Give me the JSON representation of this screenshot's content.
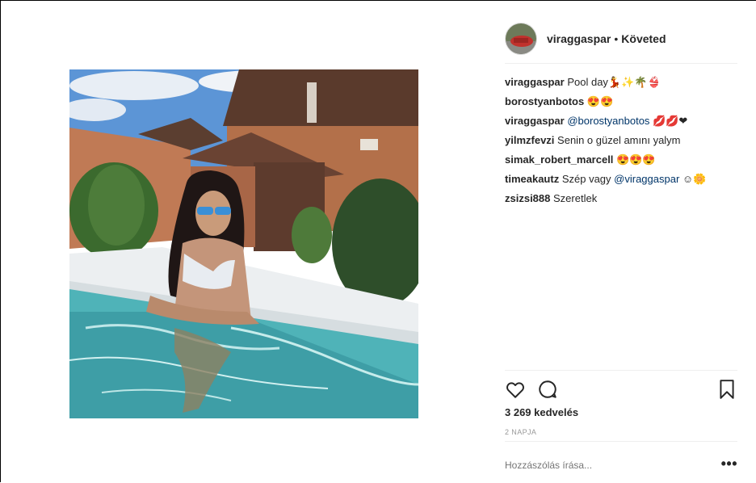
{
  "post": {
    "username": "viraggaspar",
    "separator": "•",
    "follow_status": "Követed"
  },
  "comments": [
    {
      "user": "viraggaspar",
      "text": "Pool day💃✨🌴👙"
    },
    {
      "user": "borostyanbotos",
      "text": "😍😍"
    },
    {
      "user": "viraggaspar",
      "mention": "@borostyanbotos",
      "text": " 💋💋❤"
    },
    {
      "user": "yilmzfevzi",
      "text": "Senin o güzel amını yalym"
    },
    {
      "user": "simak_robert_marcell",
      "text": "😍😍😍"
    },
    {
      "user": "timeakautz",
      "text": "Szép vagy ",
      "mention": "@viraggaspar",
      "text_after": " ☺🌼"
    },
    {
      "user": "zsizsi888",
      "text": "Szeretlek"
    }
  ],
  "stats": {
    "likes": "3 269 kedvelés",
    "time_ago": "2 NAPJA"
  },
  "add_comment": {
    "placeholder": "Hozzászólás írása..."
  },
  "icons": {
    "like": "heart-icon",
    "comment": "comment-bubble-icon",
    "save": "bookmark-icon",
    "more": "more-options-icon"
  }
}
